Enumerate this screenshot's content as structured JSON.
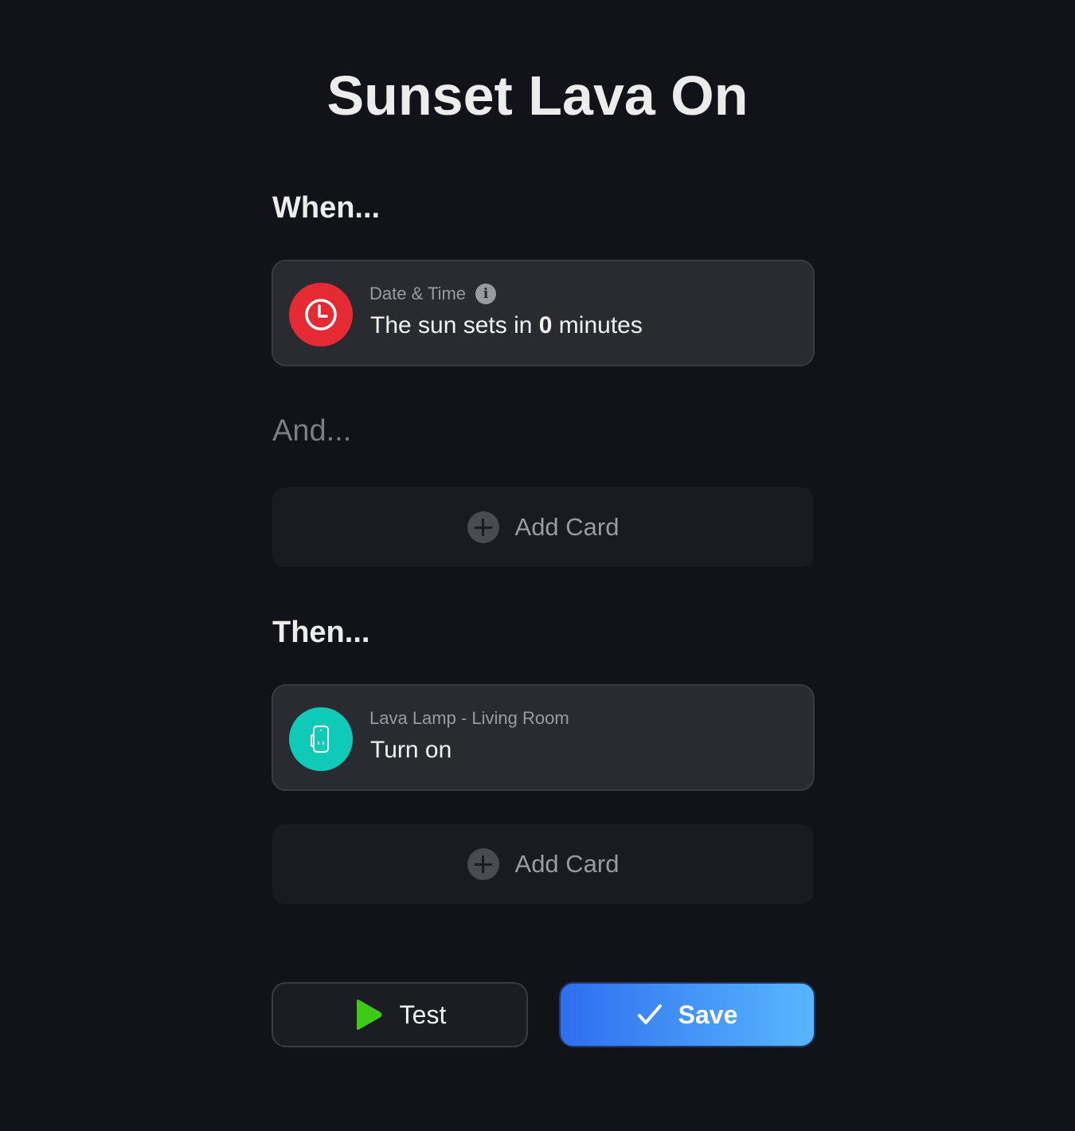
{
  "title": "Sunset Lava On",
  "when": {
    "label": "When...",
    "card": {
      "subtitle": "Date & Time",
      "text_prefix": "The sun sets in ",
      "text_value": "0",
      "text_suffix": " minutes",
      "icon": "clock-icon",
      "icon_color": "#e52a34"
    }
  },
  "and": {
    "label": "And...",
    "add_label": "Add Card"
  },
  "then": {
    "label": "Then...",
    "card": {
      "subtitle": "Lava Lamp - Living Room",
      "text": "Turn on",
      "icon": "socket-icon",
      "icon_color": "#0fcab7"
    },
    "add_label": "Add Card"
  },
  "buttons": {
    "test_label": "Test",
    "save_label": "Save"
  },
  "colors": {
    "background": "#121318",
    "play_green": "#3ecb18",
    "save_gradient_start": "#2e6ef0",
    "save_gradient_end": "#58b7ff"
  }
}
